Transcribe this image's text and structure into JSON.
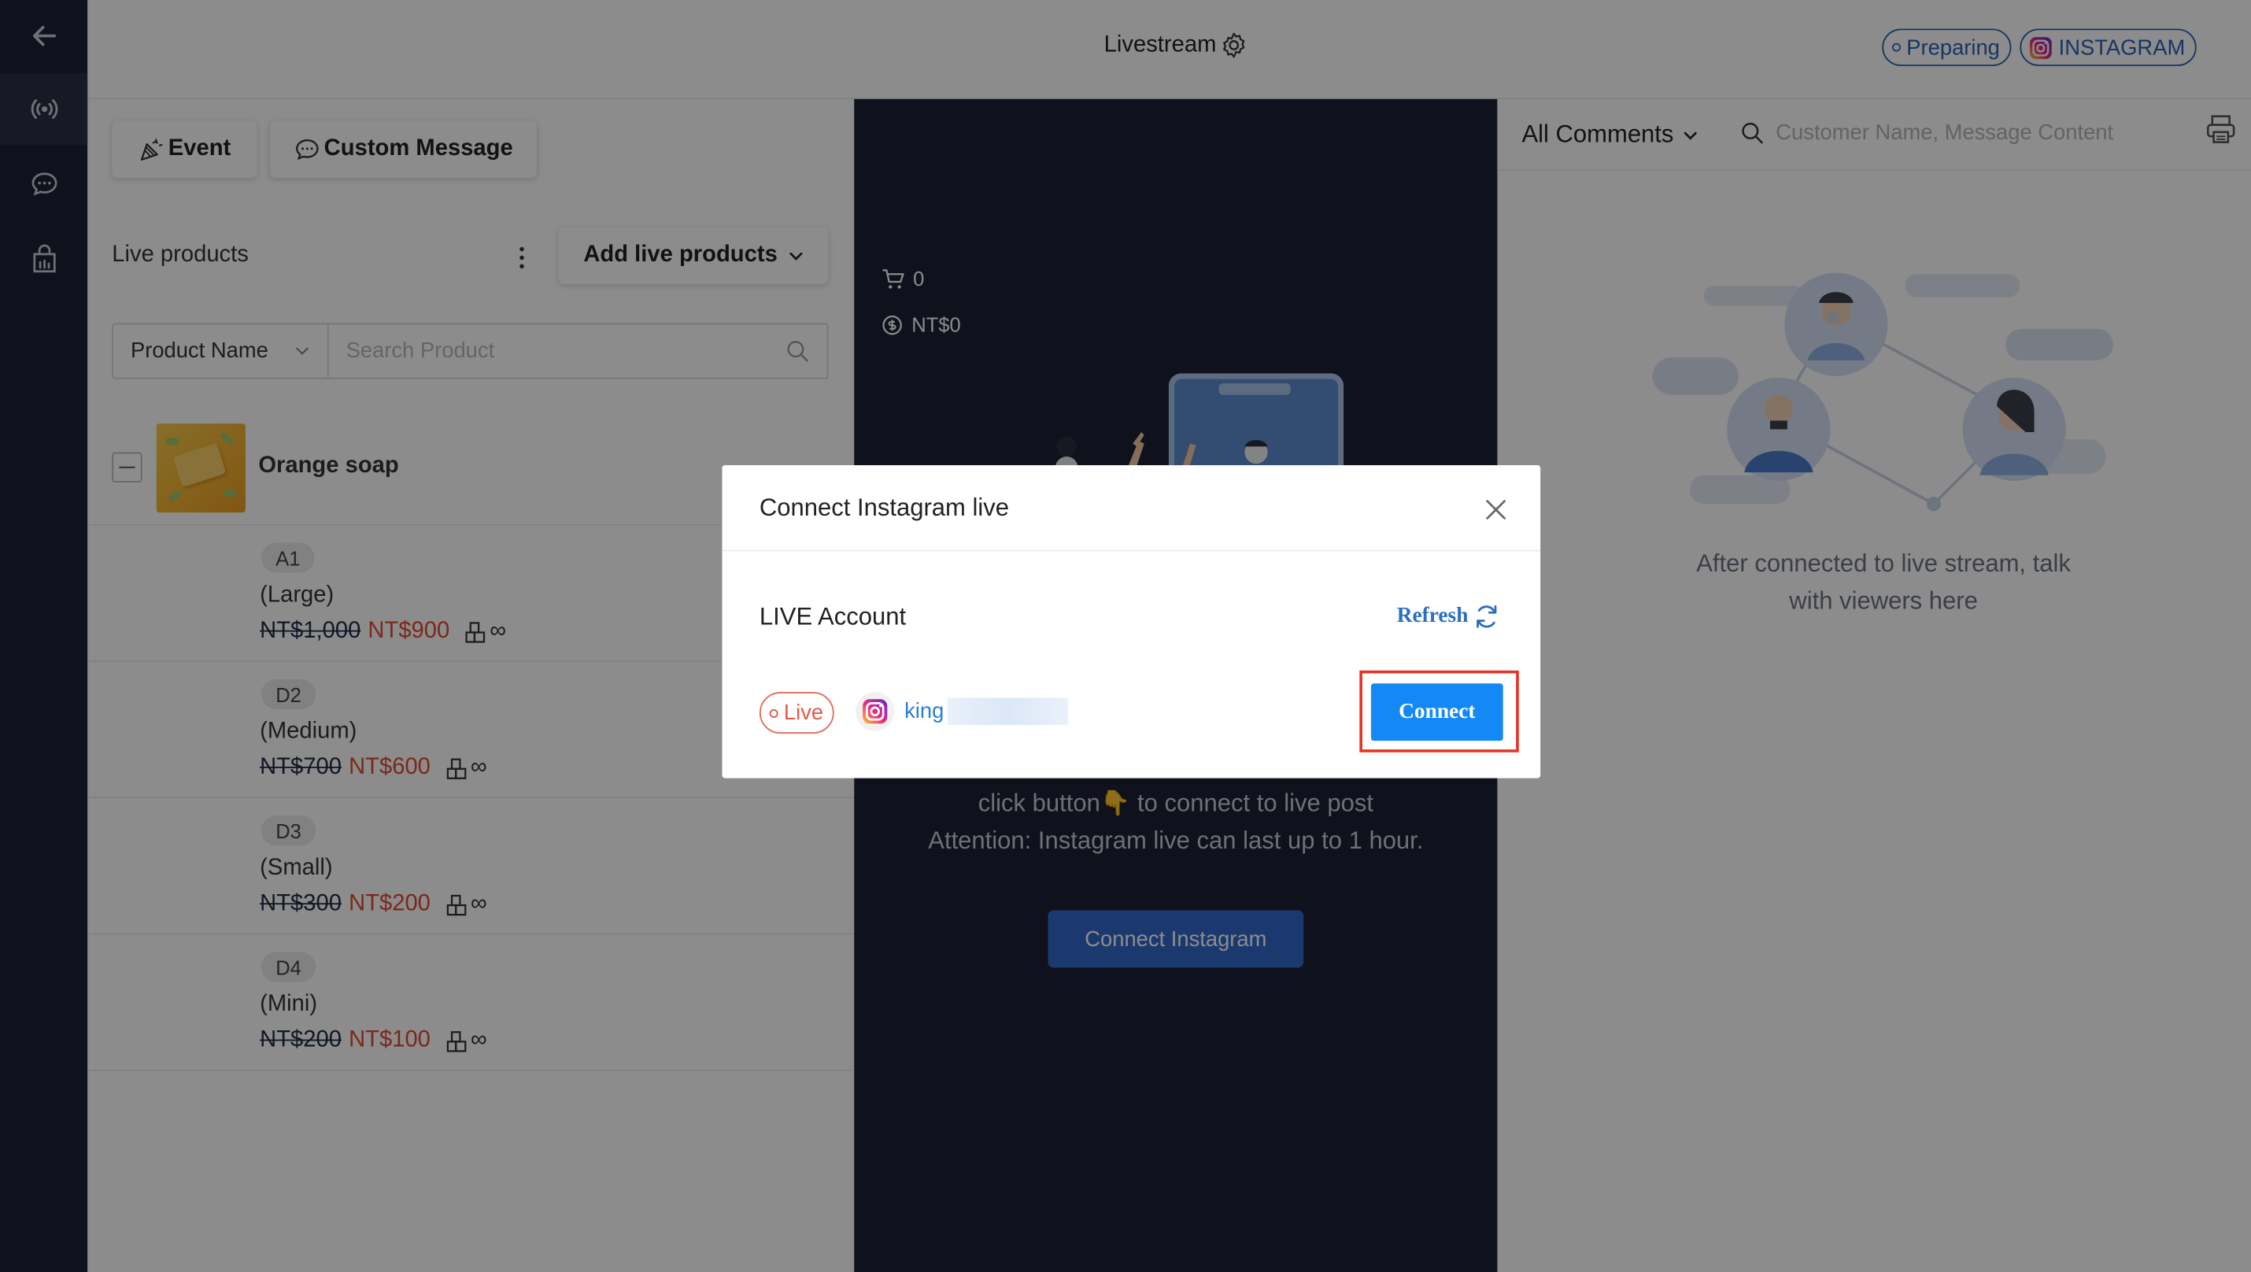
{
  "topbar": {
    "title": "Livestream",
    "status_label": "Preparing",
    "platform_label": "INSTAGRAM"
  },
  "sidebar": {
    "items": [
      {
        "icon": "back-arrow-icon"
      },
      {
        "icon": "broadcast-icon",
        "active": true
      },
      {
        "icon": "chat-icon"
      },
      {
        "icon": "shopping-bag-icon"
      }
    ]
  },
  "left_panel": {
    "tabs": [
      {
        "label": "Event",
        "icon": "party-popper-icon"
      },
      {
        "label": "Custom Message",
        "icon": "chat-bubble-icon"
      }
    ],
    "title": "Live products",
    "add_button": "Add live products",
    "search": {
      "field_select": "Product Name",
      "placeholder": "Search Product"
    },
    "product": {
      "name": "Orange soap",
      "variants": [
        {
          "code": "A1",
          "size": "(Large)",
          "old_price": "NT$1,000",
          "price": "NT$900",
          "stock": "∞"
        },
        {
          "code": "D2",
          "size": "(Medium)",
          "old_price": "NT$700",
          "price": "NT$600",
          "stock": "∞"
        },
        {
          "code": "D3",
          "size": "(Small)",
          "old_price": "NT$300",
          "price": "NT$200",
          "stock": "∞"
        },
        {
          "code": "D4",
          "size": "(Mini)",
          "old_price": "NT$200",
          "price": "NT$100",
          "stock": "∞"
        }
      ]
    }
  },
  "center": {
    "cart_count": "0",
    "revenue": "NT$0",
    "instruction_line1": "click button👇 to connect to live post",
    "instruction_line2": "Attention: Instagram live can last up to 1 hour.",
    "connect_button": "Connect Instagram"
  },
  "right_panel": {
    "filter": "All Comments",
    "search_placeholder": "Customer Name, Message Content",
    "empty_text": "After connected to live stream, talk with viewers here"
  },
  "modal": {
    "title": "Connect Instagram live",
    "section_label": "LIVE Account",
    "refresh_label": "Refresh",
    "live_badge": "Live",
    "account_name": "king",
    "connect_button": "Connect"
  },
  "colors": {
    "sidebar_bg": "#1d2233",
    "accent_blue": "#1489f5",
    "status_blue": "#2a63b5",
    "price_red": "#e04a30",
    "highlight_red": "#e53424"
  }
}
